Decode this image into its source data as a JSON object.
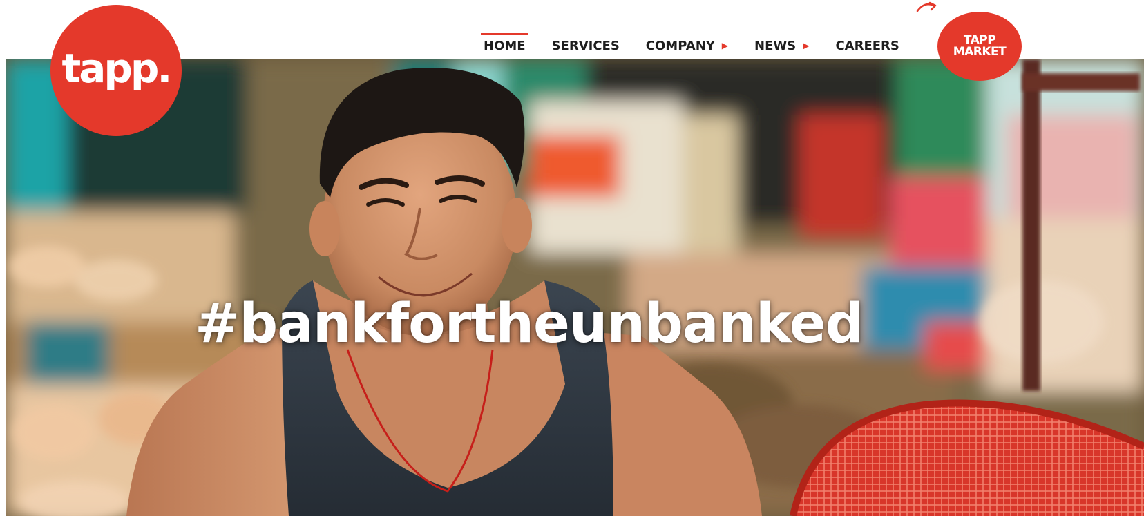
{
  "brand": {
    "logo_text": "tapp.",
    "accent_color": "#e4392b"
  },
  "nav": {
    "items": [
      {
        "label": "HOME",
        "active": true,
        "has_dropdown": false
      },
      {
        "label": "SERVICES",
        "active": false,
        "has_dropdown": false
      },
      {
        "label": "COMPANY",
        "active": false,
        "has_dropdown": true
      },
      {
        "label": "NEWS",
        "active": false,
        "has_dropdown": true
      },
      {
        "label": "CAREERS",
        "active": false,
        "has_dropdown": false
      }
    ],
    "dropdown_icon": "caret-right-icon"
  },
  "market_button": {
    "line1": "TAPP",
    "line2": "MARKET",
    "icon": "curved-arrow-icon"
  },
  "hero": {
    "tagline": "#bankfortheunbanked",
    "image": "market-vendor-photo"
  }
}
